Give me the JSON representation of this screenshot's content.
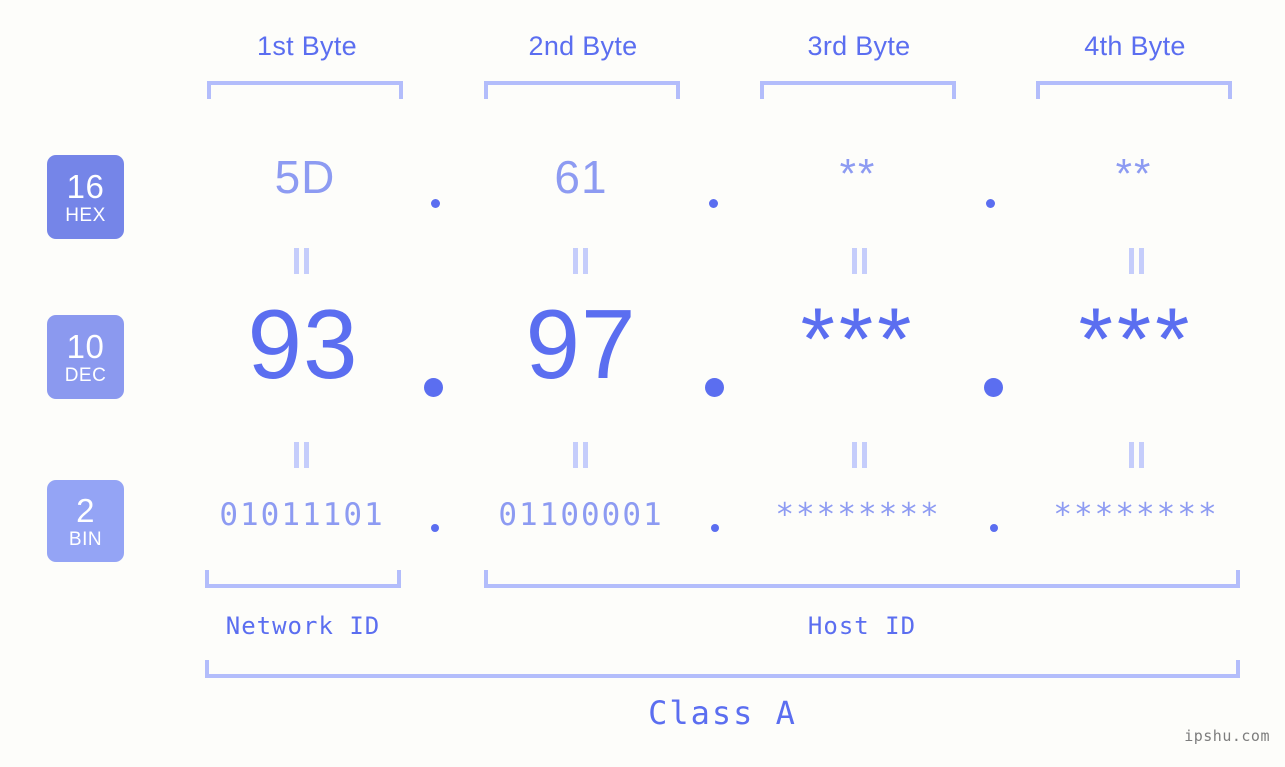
{
  "background_color": "#fdfdfa",
  "accent_color": "#5b6ef0",
  "accent_light_color": "#8d9bf2",
  "bracket_color": "#b3bdfb",
  "header": {
    "bytes": [
      {
        "label": "1st Byte"
      },
      {
        "label": "2nd Byte"
      },
      {
        "label": "3rd Byte"
      },
      {
        "label": "4th Byte"
      }
    ]
  },
  "bases": [
    {
      "id": "hex",
      "number": "16",
      "name": "HEX",
      "color": "#7585e8"
    },
    {
      "id": "dec",
      "number": "10",
      "name": "DEC",
      "color": "#8b99ef"
    },
    {
      "id": "bin",
      "number": "2",
      "name": "BIN",
      "color": "#94a4f5"
    }
  ],
  "rows": {
    "hex": {
      "values": [
        "5D",
        "61",
        "**",
        "**"
      ],
      "separator": "."
    },
    "dec": {
      "values": [
        "93",
        "97",
        "***",
        "***"
      ],
      "separator": "."
    },
    "bin": {
      "values": [
        "01011101",
        "01100001",
        "********",
        "********"
      ],
      "separator": "."
    }
  },
  "equality_marks": {
    "glyph": "||",
    "count_per_row": 4
  },
  "footer": {
    "network_id_label": "Network ID",
    "host_id_label": "Host ID",
    "class_label": "Class A"
  },
  "watermark": {
    "text": "ipshu.com"
  }
}
